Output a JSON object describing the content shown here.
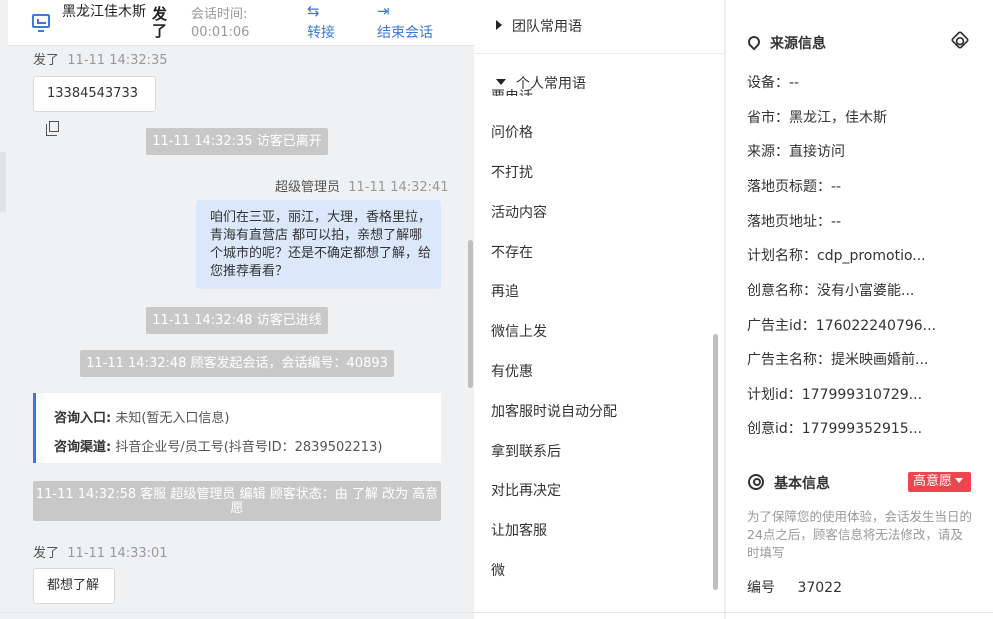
{
  "header": {
    "location": "黑龙江佳木斯",
    "sent_label": "发了",
    "session_time_label": "会话时间:",
    "session_time_value": "00:01:06",
    "transfer_label": "转接",
    "end_session_label": "结束会话"
  },
  "messages": {
    "m1_meta_sender": "发了",
    "m1_meta_time": "11-11 14:32:35",
    "m1_text": "13384543733",
    "sys_left": "11-11 14:32:35 访客已离开",
    "m2_meta_sender": "超级管理员",
    "m2_meta_time": "11-11 14:32:41",
    "m2_text": "咱们在三亚，丽江，大理，香格里拉，青海有直营店 都可以拍，亲想了解哪个城市的呢？还是不确定都想了解，给您推荐看看？",
    "sys_enter": "11-11 14:32:48 访客已进线",
    "sys_session": "11-11 14:32:48 顾客发起会话，会话编号：40893",
    "entry_label": "咨询入口:",
    "entry_value": "未知(暂无入口信息)",
    "channel_label": "咨询渠道:",
    "channel_value": "抖音企业号/员工号(抖音号ID：2839502213)",
    "status_change": "11-11 14:32:58 客服 超级管理员 编辑 顾客状态：由 了解 改为 高意愿",
    "m3_meta_sender": "发了",
    "m3_meta_time": "11-11 14:33:01",
    "m3_text": "都想了解"
  },
  "phrases": {
    "team_group": "团队常用语",
    "personal_group": "个人常用语",
    "clipped_item": "要电话",
    "items": [
      "问价格",
      "不打扰",
      "活动内容",
      "不存在",
      "再追",
      "微信上发",
      "有优惠",
      "加客服时说自动分配",
      "拿到联系后",
      "对比再决定",
      "让加客服",
      "微"
    ]
  },
  "info": {
    "source_title": "来源信息",
    "fields": [
      "设备：--",
      "省市：黑龙江，佳木斯",
      "来源：直接访问",
      "落地页标题：--",
      "落地页地址：--",
      "计划名称：cdp_promotio...",
      "创意名称：没有小富婆能...",
      "广告主id：176022240796...",
      "广告主名称：提米映画婚前...",
      "计划id：177999310729...",
      "创意id：177999352915..."
    ],
    "basic_title": "基本信息",
    "intent_badge": "高意愿",
    "notice": "为了保障您的使用体验，会话发生当日的24点之后，顾客信息将无法修改，请及时填写",
    "number_label": "编号",
    "number_value": "37022"
  },
  "icons": {
    "monitor": "monitor-icon",
    "transfer": "transfer-arrows-icon",
    "exit": "exit-icon",
    "copy": "copy-icon",
    "location": "location-pin-icon",
    "settings": "gear-icon",
    "user": "user-circle-icon"
  },
  "colors": {
    "accent": "#3a7bd5",
    "bubble": "#dbe8fb",
    "system": "#c8c8c8",
    "badge": "#f0454e"
  }
}
